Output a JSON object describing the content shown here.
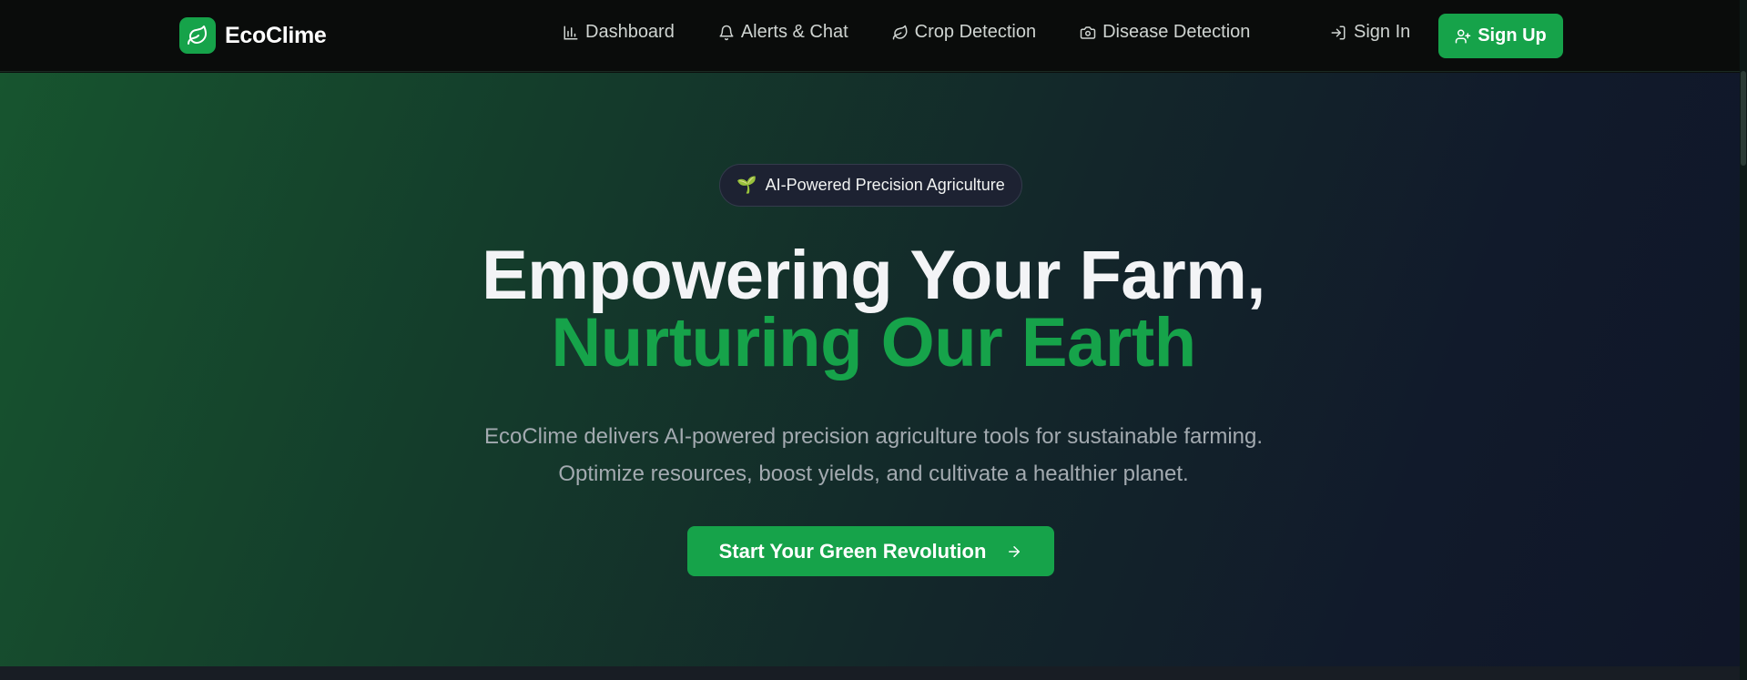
{
  "brand": {
    "name": "EcoClime",
    "icon": "leaf-icon",
    "color": "#16a34a"
  },
  "nav": {
    "items": [
      {
        "label": "Dashboard",
        "icon": "bar-chart-icon"
      },
      {
        "label": "Alerts & Chat",
        "icon": "bell-icon"
      },
      {
        "label": "Crop Detection",
        "icon": "leaf-icon"
      },
      {
        "label": "Disease Detection",
        "icon": "camera-icon"
      }
    ],
    "sign_in": "Sign In",
    "sign_up": "Sign Up"
  },
  "hero": {
    "badge": {
      "emoji": "🌱",
      "label": "AI-Powered Precision Agriculture"
    },
    "headline_line1": "Empowering Your Farm,",
    "headline_line2": "Nurturing Our Earth",
    "subtitle_line1": "EcoClime delivers AI-powered precision agriculture tools for sustainable farming.",
    "subtitle_line2": "Optimize resources, boost yields, and cultivate a healthier planet.",
    "cta": "Start Your Green Revolution"
  },
  "colors": {
    "accent": "#16a34a",
    "navbar": "#0a0c0b",
    "heading": "#f3f4f6",
    "muted": "#a3aab0"
  }
}
